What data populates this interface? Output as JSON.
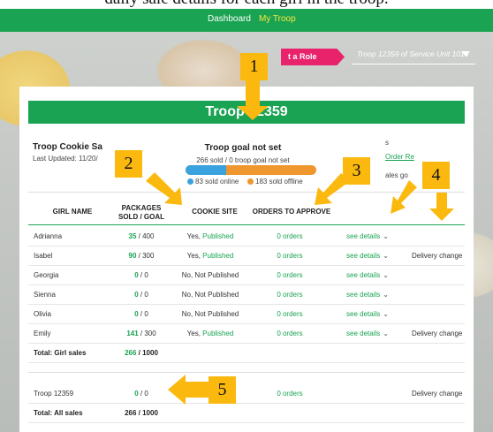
{
  "caption": "daily sale details for each girl in the troop.",
  "nav": {
    "dashboard": "Dashboard",
    "my_troop": "My Troop"
  },
  "role_button": "t a Role",
  "troop_select": "Troop 12359 of Service Unit 1016",
  "banner": "Troop 12359",
  "summary": {
    "title": "Troop Cookie Sa",
    "updated": "Last Updated: 11/20/"
  },
  "goal": {
    "title": "Troop goal not set",
    "subtitle": "266 sold / 0 troop goal not set",
    "online_fraction": 0.312,
    "online_label": "83 sold online",
    "offline_label": "183 sold offline"
  },
  "right_fragments": {
    "top": "s",
    "order_link": "Order Re",
    "sales": "ales go"
  },
  "headers": {
    "girl_name": "GIRL NAME",
    "packages_line1": "PACKAGES",
    "packages_line2": "SOLD / GOAL",
    "cookie_site": "COOKIE SITE",
    "orders": "ORDERS TO APPROVE"
  },
  "rows": [
    {
      "name": "Adrianna",
      "sold": "35",
      "goal": " / 400",
      "site_prefix": "Yes, ",
      "site_status": "Published",
      "orders": "0 orders",
      "details": "see details",
      "delivery": ""
    },
    {
      "name": "Isabel",
      "sold": "90",
      "goal": " / 300",
      "site_prefix": "Yes, ",
      "site_status": "Published",
      "orders": "0 orders",
      "details": "see details",
      "delivery": "Delivery change"
    },
    {
      "name": "Georgia",
      "sold": "0",
      "goal": " / 0",
      "site_prefix": "No, Not Published",
      "site_status": "",
      "orders": "0 orders",
      "details": "see details",
      "delivery": ""
    },
    {
      "name": "Sienna",
      "sold": "0",
      "goal": " / 0",
      "site_prefix": "No, Not Published",
      "site_status": "",
      "orders": "0 orders",
      "details": "see details",
      "delivery": ""
    },
    {
      "name": "Olivia",
      "sold": "0",
      "goal": " / 0",
      "site_prefix": "No, Not Published",
      "site_status": "",
      "orders": "0 orders",
      "details": "see details",
      "delivery": ""
    },
    {
      "name": "Emily",
      "sold": "141",
      "goal": " / 300",
      "site_prefix": "Yes, ",
      "site_status": "Published",
      "orders": "0 orders",
      "details": "see details",
      "delivery": "Delivery change"
    }
  ],
  "total_girl": {
    "label": "Total: Girl sales",
    "sold": "266",
    "goal": " / 1000"
  },
  "troop_row": {
    "name": "Troop 12359",
    "sold": "0",
    "goal": " / 0",
    "orders": "0 orders",
    "delivery": "Delivery change"
  },
  "total_all": {
    "label": "Total: All sales",
    "value": "266 / 1000"
  },
  "callouts": [
    "1",
    "2",
    "3",
    "4",
    "5"
  ],
  "colors": {
    "green": "#1aa352",
    "pink": "#e8236c",
    "callout": "#fbb910",
    "online": "#3aa3df",
    "offline": "#f0962e"
  }
}
